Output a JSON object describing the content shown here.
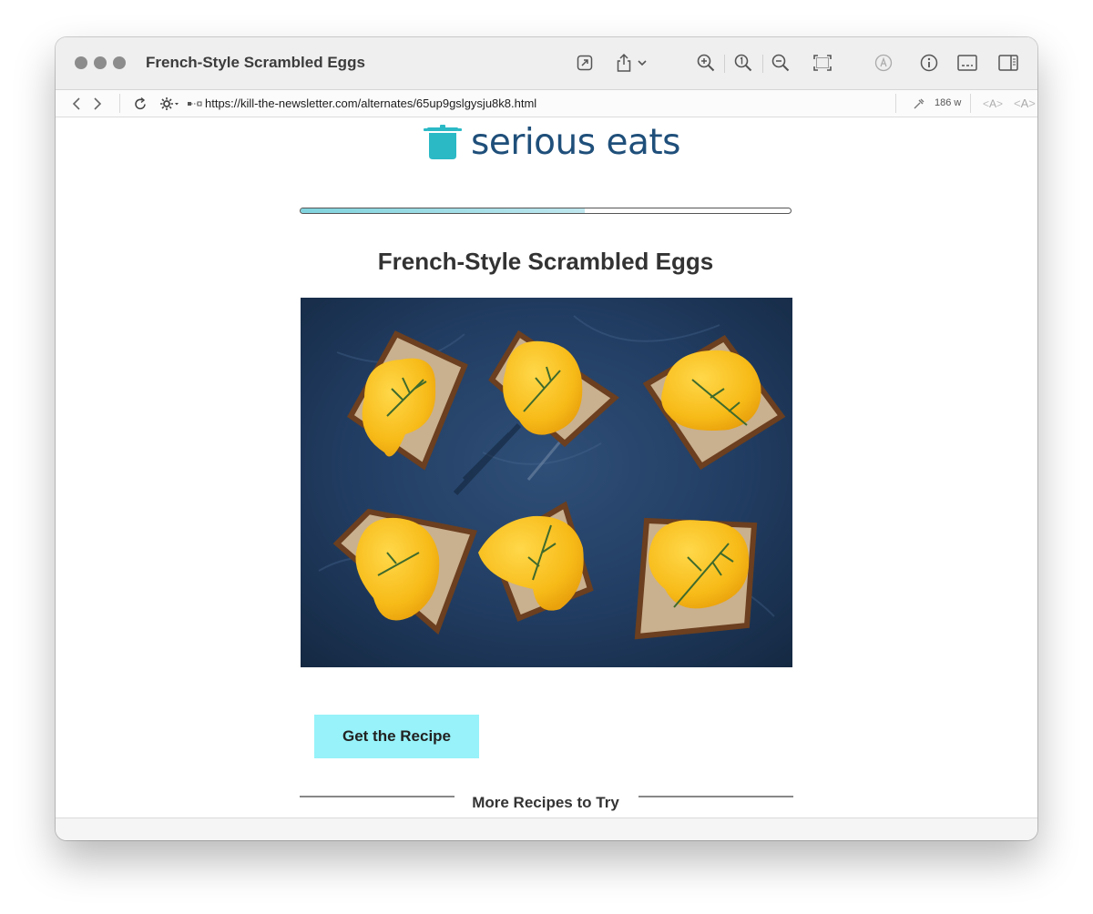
{
  "window": {
    "title": "French-Style Scrambled Eggs"
  },
  "toolbar": {
    "icons": [
      "open-external-icon",
      "share-icon",
      "chevron-down-icon",
      "zoom-in-icon",
      "actual-size-icon",
      "zoom-out-icon",
      "fit-screen-icon",
      "markup-icon",
      "info-icon",
      "subtitles-icon",
      "sidebar-icon"
    ]
  },
  "address_bar": {
    "url": "https://kill-the-newsletter.com/alternates/65up9gslgysju8k8.html",
    "word_count": "186 w",
    "font_smaller": "A",
    "font_larger": "A"
  },
  "page": {
    "logo_text": "serious eats",
    "brand_color": "#2bb9c6",
    "logo_text_color": "#1f4f7a",
    "reading_progress": 0.58,
    "title": "French-Style Scrambled Eggs",
    "cta_label": "Get the Recipe",
    "cta_color": "#97f2f9",
    "section_heading": "More Recipes to Try"
  }
}
